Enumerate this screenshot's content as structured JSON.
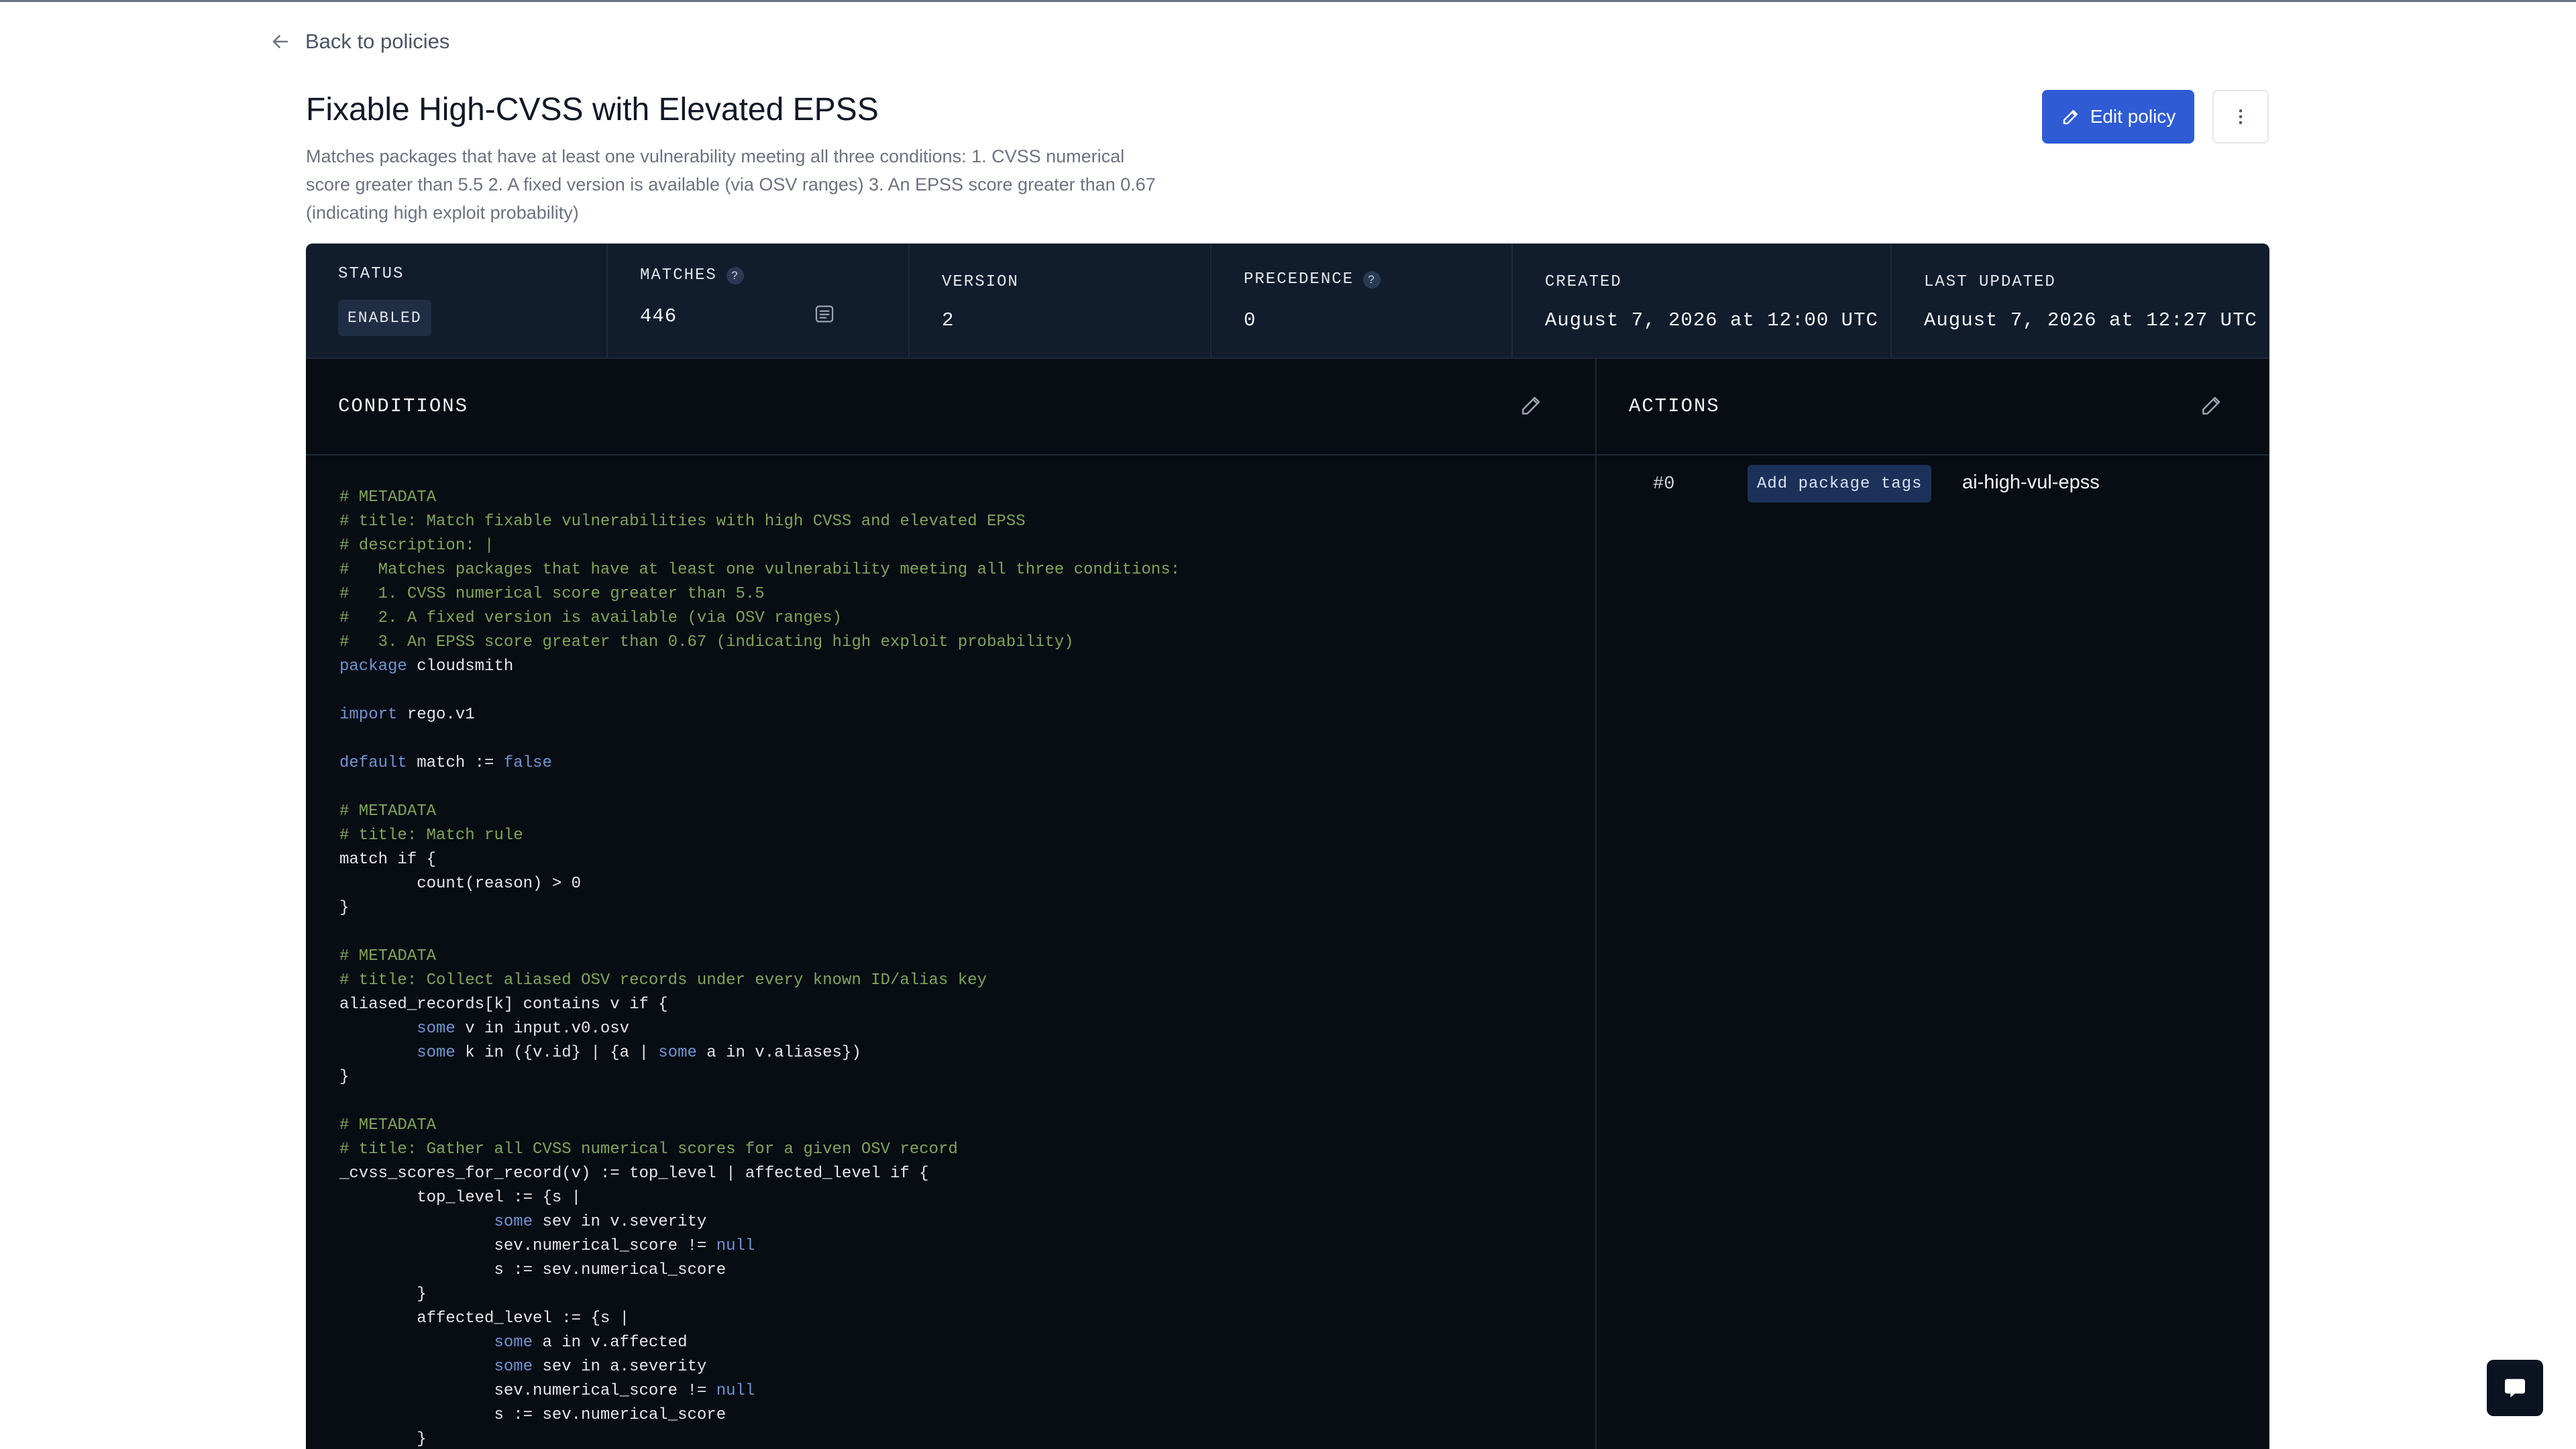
{
  "nav": {
    "back_label": "Back to policies"
  },
  "policy": {
    "title": "Fixable High-CVSS with Elevated EPSS",
    "description": "Matches packages that have at least one vulnerability meeting all three conditions: 1. CVSS numerical score greater than 5.5 2. A fixed version is available (via OSV ranges) 3. An EPSS score greater than 0.67 (indicating high exploit probability)"
  },
  "buttons": {
    "edit_label": "Edit policy",
    "more_icon": "vertical-dots-icon",
    "edit_icon": "pencil-icon"
  },
  "stats": {
    "status": {
      "label": "STATUS",
      "value": "ENABLED"
    },
    "matches": {
      "label": "MATCHES",
      "help": "?",
      "value": "446",
      "icon": "list-icon"
    },
    "version": {
      "label": "VERSION",
      "value": "2"
    },
    "precedence": {
      "label": "PRECEDENCE",
      "help": "?",
      "value": "0"
    },
    "created": {
      "label": "CREATED",
      "value": "August 7, 2026 at 12:00 UTC"
    },
    "updated": {
      "label": "LAST UPDATED",
      "value": "August 7, 2026 at 12:27 UTC"
    }
  },
  "conditions": {
    "title": "CONDITIONS",
    "code": [
      "# METADATA",
      "# title: Match fixable vulnerabilities with high CVSS and elevated EPSS",
      "# description: |",
      "#   Matches packages that have at least one vulnerability meeting all three conditions:",
      "#   1. CVSS numerical score greater than 5.5",
      "#   2. A fixed version is available (via OSV ranges)",
      "#   3. An EPSS score greater than 0.67 (indicating high exploit probability)",
      "package cloudsmith",
      "",
      "import rego.v1",
      "",
      "default match := false",
      "",
      "# METADATA",
      "# title: Match rule",
      "match if {",
      "\tcount(reason) > 0",
      "}",
      "",
      "# METADATA",
      "# title: Collect aliased OSV records under every known ID/alias key",
      "aliased_records[k] contains v if {",
      "\tsome v in input.v0.osv",
      "\tsome k in ({v.id} | {a | some a in v.aliases})",
      "}",
      "",
      "# METADATA",
      "# title: Gather all CVSS numerical scores for a given OSV record",
      "_cvss_scores_for_record(v) := top_level | affected_level if {",
      "\ttop_level := {s |",
      "\t\tsome sev in v.severity",
      "\t\tsev.numerical_score != null",
      "\t\ts := sev.numerical_score",
      "\t}",
      "\taffected_level := {s |",
      "\t\tsome a in v.affected",
      "\t\tsome sev in a.severity",
      "\t\tsev.numerical_score != null",
      "\t\ts := sev.numerical_score",
      "\t}"
    ]
  },
  "actions": {
    "title": "ACTIONS",
    "items": [
      {
        "index": "#0",
        "type": "Add package tags",
        "value": "ai-high-vul-epss"
      }
    ]
  },
  "colors": {
    "primary": "#2f5bd5",
    "panel_bg": "#080c13",
    "stats_bg": "#111d2d",
    "comment": "#7ea65a",
    "keyword": "#6f95d2"
  },
  "chat": {
    "icon": "chat-bubble-icon"
  }
}
